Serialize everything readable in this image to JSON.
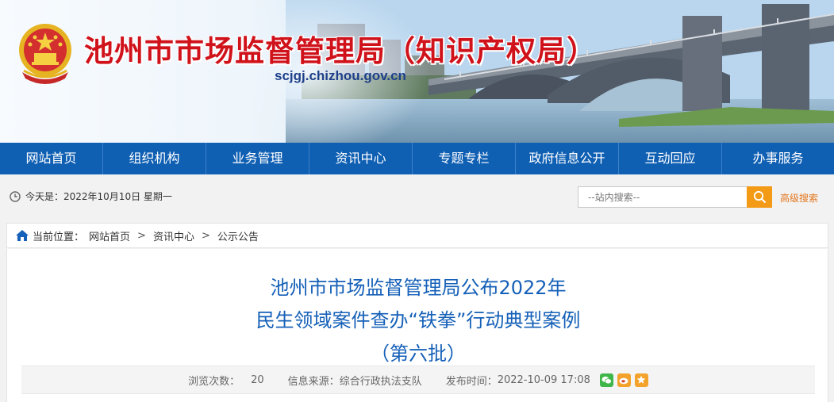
{
  "header": {
    "title": "池州市市场监督管理局（知识产权局）",
    "domain": "scjgj.chizhou.gov.cn"
  },
  "nav": {
    "items": [
      "网站首页",
      "组织机构",
      "业务管理",
      "资讯中心",
      "专题专栏",
      "政府信息公开",
      "互动回应",
      "办事服务"
    ]
  },
  "topbar": {
    "date_text": "今天是：2022年10月10日 星期一",
    "search_placeholder": "--站内搜索--",
    "advanced_search": "高级搜索"
  },
  "breadcrumb": {
    "label": "当前位置：",
    "items": [
      "网站首页",
      "资讯中心",
      "公示公告"
    ],
    "separator": ">"
  },
  "article": {
    "title_line1": "池州市市场监督管理局公布2022年",
    "title_line2": "民生领域案件查办“铁拳”行动典型案例",
    "title_line3": "（第六批）",
    "views_label": "浏览次数：",
    "views": "20",
    "source_label": "信息来源：",
    "source": "综合行政执法支队",
    "time_label": "发布时间：",
    "time": "2022-10-09 17:08"
  },
  "icons": {
    "emblem": "national-emblem-icon",
    "clock": "clock-icon",
    "search": "search-icon",
    "home": "home-icon",
    "share": [
      "wechat-icon",
      "weibo-icon",
      "favorite-icon"
    ]
  },
  "colors": {
    "nav_bg": "#0f5fb3",
    "title_red": "#d0121b",
    "article_title": "#1560b8",
    "search_btn": "#f39a16"
  }
}
